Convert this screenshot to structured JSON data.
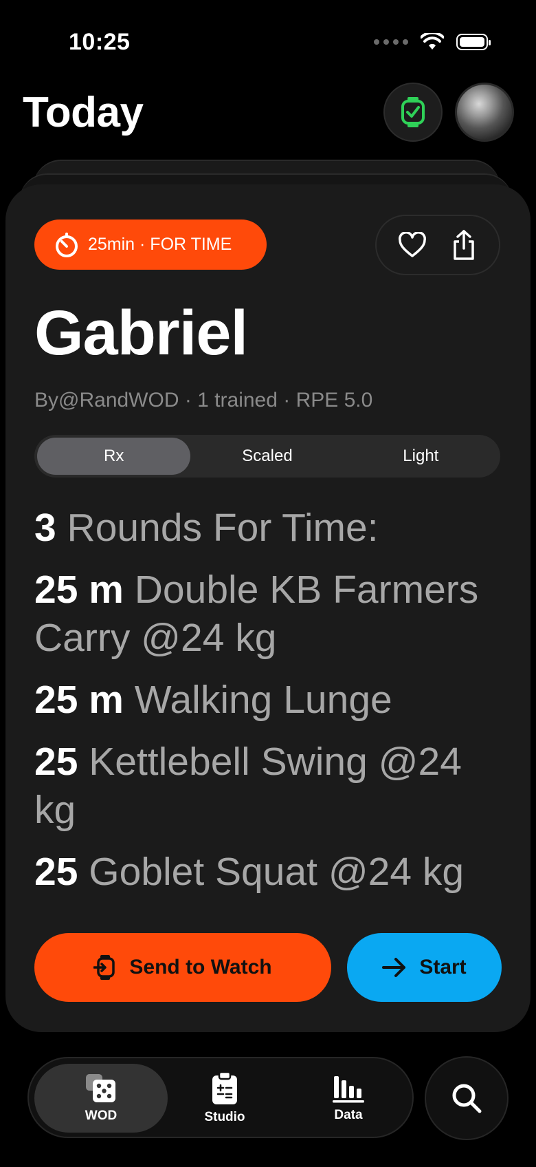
{
  "status_bar": {
    "time": "10:25"
  },
  "header": {
    "title": "Today"
  },
  "card": {
    "timer_badge": "25min · FOR TIME",
    "name": "Gabriel",
    "meta": "By@RandWOD · 1 trained · RPE 5.0",
    "segments": [
      {
        "label": "Rx",
        "selected": true
      },
      {
        "label": "Scaled",
        "selected": false
      },
      {
        "label": "Light",
        "selected": false
      }
    ],
    "workout": [
      {
        "qty": "3",
        "text": "Rounds For Time:"
      },
      {
        "qty": "25 m",
        "text": "Double KB Farmers Carry @24 kg"
      },
      {
        "qty": "25 m",
        "text": "Walking Lunge"
      },
      {
        "qty": "25",
        "text": "Kettlebell Swing @24 kg"
      },
      {
        "qty": "25",
        "text": "Goblet Squat @24 kg"
      }
    ],
    "send_button": "Send to Watch",
    "start_button": "Start"
  },
  "tabbar": {
    "tabs": [
      {
        "label": "WOD",
        "icon": "dice-icon",
        "active": true
      },
      {
        "label": "Studio",
        "icon": "clipboard-icon",
        "active": false
      },
      {
        "label": "Data",
        "icon": "bar-chart-icon",
        "active": false
      }
    ]
  },
  "colors": {
    "accent_orange": "#ff4a0a",
    "accent_blue": "#0aa8f2",
    "watch_green": "#2fd158"
  }
}
